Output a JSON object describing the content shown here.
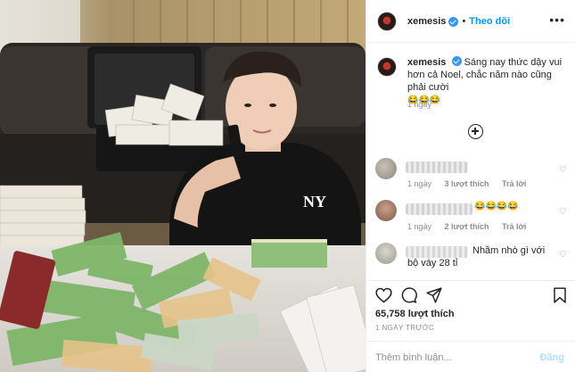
{
  "post": {
    "username": "xemesis",
    "separator": "•",
    "follow_label": "Theo dõi",
    "more_label": "•••",
    "caption_text": "Sáng nay thức dậy vui hơn cả Noel, chắc năm nào cũng phải cười",
    "caption_emoji": "😂😂😂",
    "caption_time": "1 ngày",
    "likes": "65,758 lượt thích",
    "time_ago": "1 NGÀY TRƯỚC",
    "comment_placeholder": "Thêm bình luận...",
    "post_button": "Đăng"
  },
  "comments": [
    {
      "text": "",
      "time": "1 ngày",
      "likes": "3 lượt thích",
      "reply": "Trả lời"
    },
    {
      "text": "😂😂😂😂",
      "time": "1 ngày",
      "likes": "2 lượt thích",
      "reply": "Trả lời"
    },
    {
      "text": "Nhầm nhò gì với bộ váy 28 tỉ",
      "time": "",
      "likes": "",
      "reply": ""
    }
  ],
  "icons": {
    "verified": "verified-badge-icon",
    "add_comments": "plus-circle-icon",
    "like": "heart-icon",
    "comment": "comment-bubble-icon",
    "share": "paper-plane-icon",
    "save": "bookmark-icon"
  },
  "colors": {
    "accent": "#0095f6",
    "verified": "#3897f0",
    "muted": "#8e8e8e"
  }
}
